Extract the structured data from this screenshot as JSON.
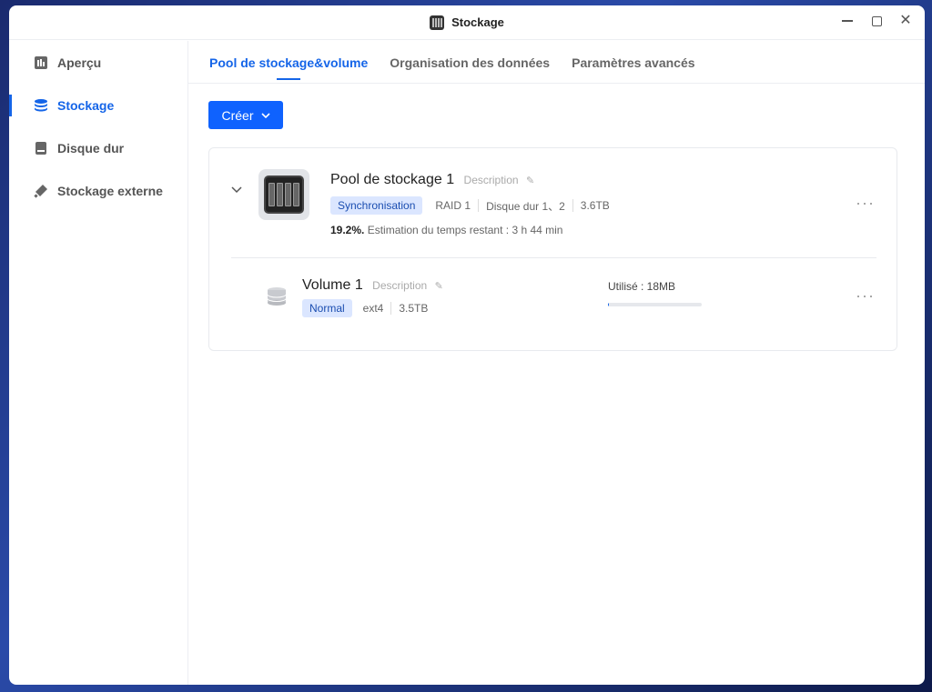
{
  "window": {
    "title": "Stockage"
  },
  "sidebar": {
    "items": [
      {
        "label": "Aperçu",
        "icon": "chart-icon"
      },
      {
        "label": "Stockage",
        "icon": "database-icon",
        "active": true
      },
      {
        "label": "Disque dur",
        "icon": "hard-drive-icon"
      },
      {
        "label": "Stockage externe",
        "icon": "usb-icon"
      }
    ]
  },
  "tabs": [
    {
      "label": "Pool de stockage&volume",
      "active": true
    },
    {
      "label": "Organisation des données"
    },
    {
      "label": "Paramètres avancés"
    }
  ],
  "toolbar": {
    "create_label": "Créer"
  },
  "pool": {
    "name": "Pool de stockage 1",
    "description_link": "Description",
    "status_badge": "Synchronisation",
    "raid": "RAID 1",
    "disks": "Disque dur 1、2",
    "capacity": "3.6TB",
    "progress_percent": "19.2%.",
    "progress_text": "Estimation du temps restant : 3 h 44 min"
  },
  "volume": {
    "name": "Volume 1",
    "description_link": "Description",
    "status_badge": "Normal",
    "filesystem": "ext4",
    "capacity": "3.5TB",
    "used_label": "Utilisé : 18MB",
    "used_fraction": 0.005
  },
  "colors": {
    "accent": "#1565e8",
    "button": "#0f62fe",
    "badge_bg": "#dbe6ff"
  }
}
